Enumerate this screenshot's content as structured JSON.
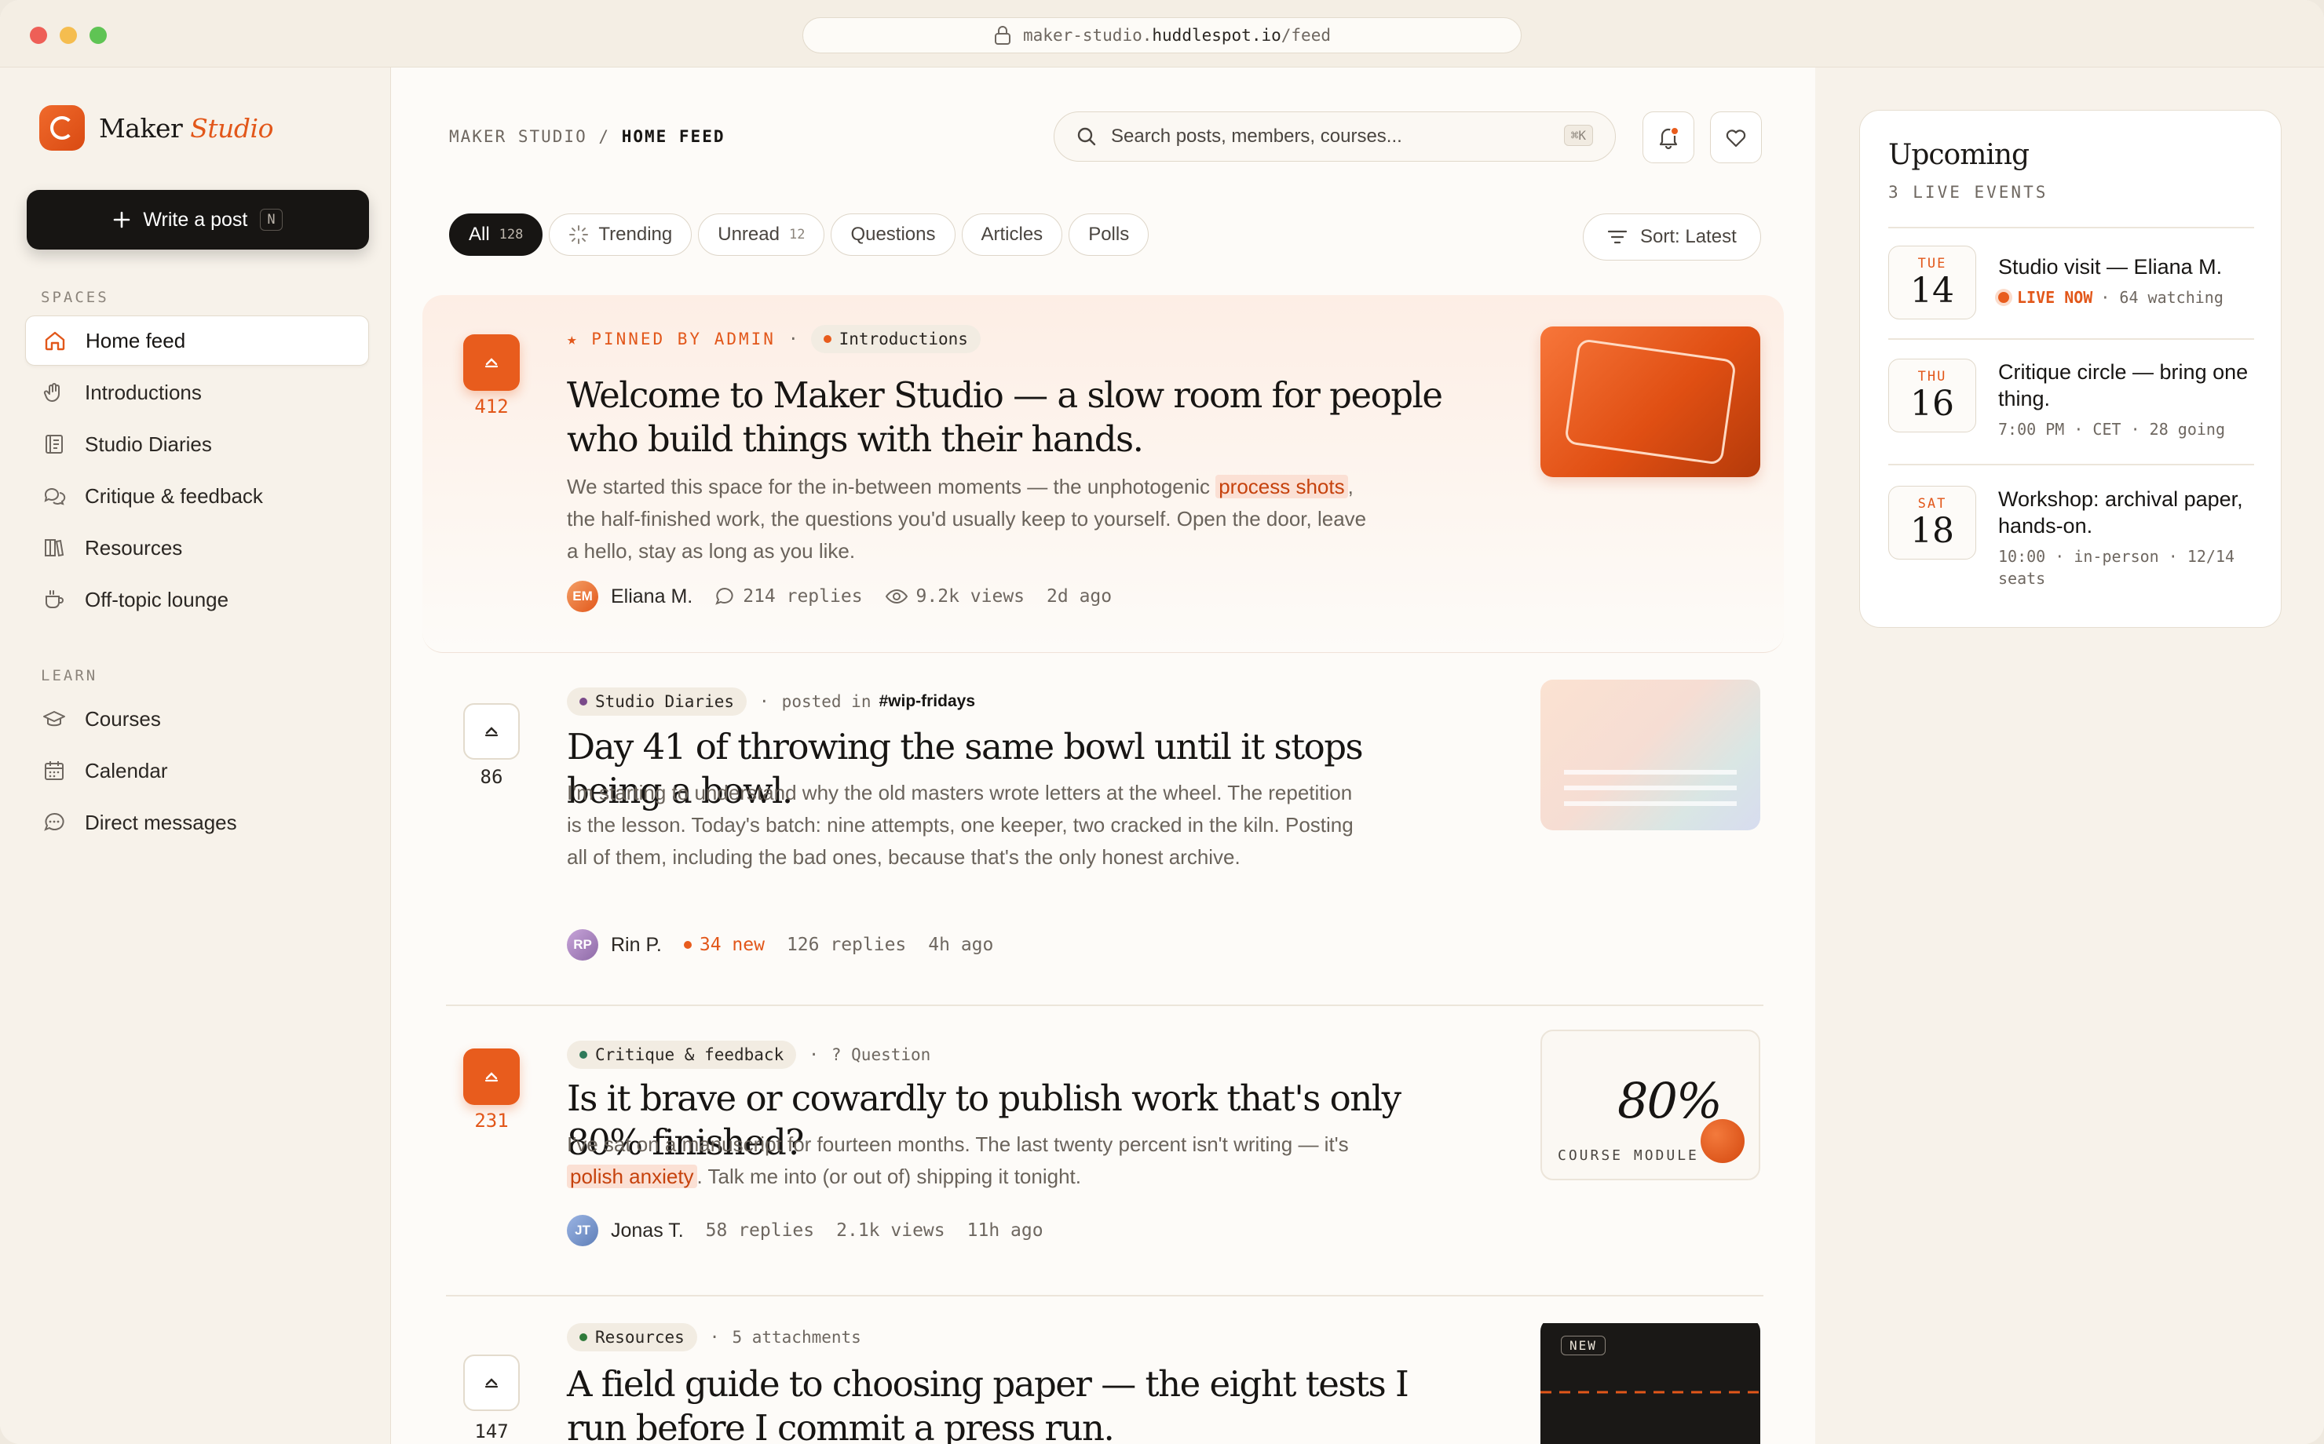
{
  "browser": {
    "url_prefix": "maker-studio.",
    "url_domain": "huddlespot.io",
    "url_path": "/feed"
  },
  "brand": {
    "name": "Maker",
    "name_accent": "Studio"
  },
  "sidebar": {
    "write_label": "Write a post",
    "write_kbd": "N",
    "spaces_label": "SPACES",
    "learn_label": "LEARN",
    "spaces": [
      {
        "label": "Home feed",
        "icon": "home-icon"
      },
      {
        "label": "Introductions",
        "icon": "wave-hand-icon"
      },
      {
        "label": "Studio Diaries",
        "icon": "notebook-icon"
      },
      {
        "label": "Critique & feedback",
        "icon": "chat-bubbles-icon"
      },
      {
        "label": "Resources",
        "icon": "books-icon"
      },
      {
        "label": "Off-topic lounge",
        "icon": "coffee-cup-icon"
      }
    ],
    "learn": [
      {
        "label": "Courses",
        "icon": "graduation-cap-icon"
      },
      {
        "label": "Calendar",
        "icon": "calendar-icon"
      },
      {
        "label": "Direct messages",
        "icon": "message-icon"
      }
    ]
  },
  "header": {
    "crumb1": "MAKER STUDIO",
    "crumb_sep": "/",
    "crumb2": "HOME FEED",
    "search_placeholder": "Search posts, members, courses...",
    "search_kbd": "⌘K"
  },
  "filters": [
    {
      "label": "All",
      "count": "128"
    },
    {
      "label": "Trending",
      "count": ""
    },
    {
      "label": "Unread",
      "count": "12"
    },
    {
      "label": "Questions",
      "count": ""
    },
    {
      "label": "Articles",
      "count": ""
    },
    {
      "label": "Polls",
      "count": ""
    }
  ],
  "sort_label": "Sort: Latest",
  "posts": [
    {
      "votes": "412",
      "pinned_label": "★ PINNED BY ADMIN",
      "sep": "·",
      "tag": "Introductions",
      "title": "Welcome to Maker Studio — a slow room for people who build things with their hands.",
      "body_1": "We started this space for the in-between moments — the unphotogenic ",
      "body_hl": "process shots",
      "body_2": ", the half-finished work, the questions you'd usually keep to yourself. Open the door, leave a hello, stay as long as you like.",
      "author_initials": "EM",
      "author": "Eliana M.",
      "replies": "214 replies",
      "views": "9.2k views",
      "time": "2d ago"
    },
    {
      "votes": "86",
      "tag": "Studio Diaries",
      "sep": "·",
      "posted_in": "posted in",
      "channel": "#wip-fridays",
      "title": "Day 41 of throwing the same bowl until it stops being a bowl.",
      "body": "I'm starting to understand why the old masters wrote letters at the wheel. The repetition is the lesson. Today's batch: nine attempts, one keeper, two cracked in the kiln. Posting all of them, including the bad ones, because that's the only honest archive.",
      "author_initials": "RP",
      "author": "Rin P.",
      "new": "34 new",
      "replies": "126 replies",
      "time": "4h ago"
    },
    {
      "votes": "231",
      "tag": "Critique & feedback",
      "sep": "·",
      "kind": "? Question",
      "title": "Is it brave or cowardly to publish work that's only 80% finished?",
      "body_1": "I've sat on a manuscript for fourteen months. The last twenty percent isn't writing — it's ",
      "body_hl": "polish anxiety",
      "body_2": ". Talk me into (or out of) shipping it tonight.",
      "author_initials": "JT",
      "author": "Jonas T.",
      "replies": "58 replies",
      "views": "2.1k views",
      "time": "11h ago",
      "thumb_big": "80%",
      "thumb_label": "COURSE MODULE"
    },
    {
      "votes": "147",
      "tag": "Resources",
      "sep": "·",
      "attachments": "5 attachments",
      "title": "A field guide to choosing paper — the eight tests I run before I commit a press run.",
      "thumb_badge": "NEW"
    }
  ],
  "upcoming": {
    "title": "Upcoming",
    "subtitle": "3 LIVE EVENTS",
    "events": [
      {
        "dow": "TUE",
        "day": "14",
        "title": "Studio visit — Eliana M.",
        "live": "LIVE NOW",
        "meta": "· 64 watching"
      },
      {
        "dow": "THU",
        "day": "16",
        "title": "Critique circle — bring one thing.",
        "meta": "7:00 PM · CET · 28 going"
      },
      {
        "dow": "SAT",
        "day": "18",
        "title": "Workshop: archival paper, hands-on.",
        "meta": "10:00 · in-person · 12/14 seats"
      }
    ]
  },
  "colors": {
    "accent": "#e2571a",
    "ink": "#171513",
    "bg": "#fbf8f3"
  }
}
